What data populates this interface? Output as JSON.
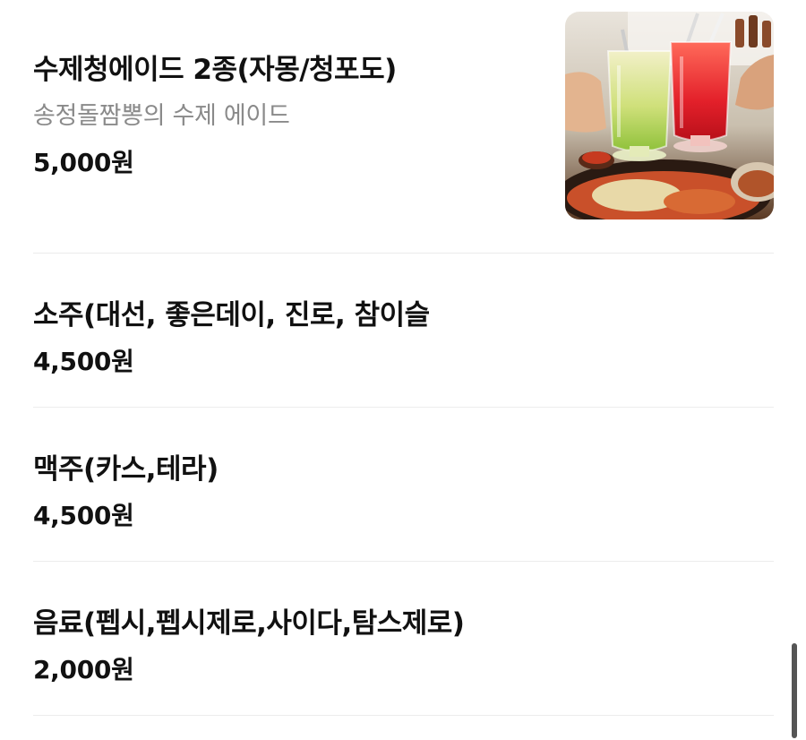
{
  "menu": {
    "items": [
      {
        "name": "수제청에이드 2종(자몽/청포도)",
        "description": "송정돌짬뽕의 수제 에이드",
        "price": "5,000원",
        "image": "ade-drinks-photo"
      },
      {
        "name": "소주(대선, 좋은데이, 진로, 참이슬",
        "price": "4,500원"
      },
      {
        "name": "맥주(카스,테라)",
        "price": "4,500원"
      },
      {
        "name": "음료(펩시,펩시제로,사이다,탐스제로)",
        "price": "2,000원"
      }
    ]
  },
  "colors": {
    "text": "#111111",
    "description": "#8a8a8a",
    "divider": "#ececec",
    "scrollbar": "#555555"
  }
}
